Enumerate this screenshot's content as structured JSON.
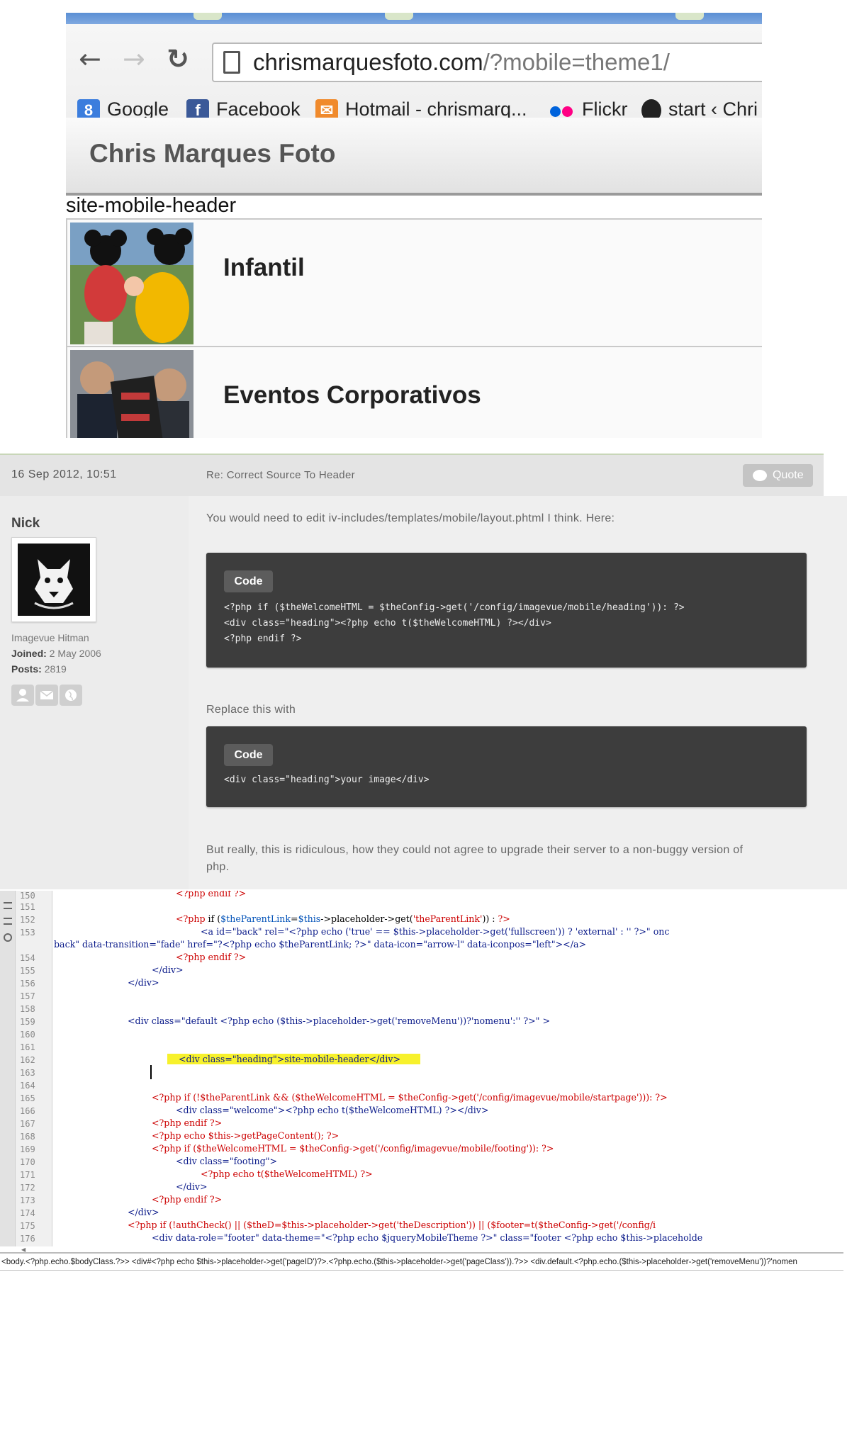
{
  "browser": {
    "url_host": "chrismarquesfoto.com",
    "url_path": "/?mobile=theme1/",
    "bookmarks": [
      {
        "label": "Google",
        "icon": "google-icon"
      },
      {
        "label": "Facebook",
        "icon": "facebook-icon"
      },
      {
        "label": "Hotmail - chrismarq...",
        "icon": "hotmail-icon"
      },
      {
        "label": "Flickr",
        "icon": "flickr-icon"
      },
      {
        "label": "start ‹ Chri",
        "icon": "wordpress-icon"
      }
    ],
    "site_title": "Chris Marques Foto",
    "raw_header_text": "site-mobile-header",
    "list": [
      {
        "label": "Infantil"
      },
      {
        "label": "Eventos Corporativos"
      }
    ]
  },
  "post": {
    "date": "16 Sep 2012, 10:51",
    "subject": "Re: Correct Source To Header",
    "quote_label": "Quote",
    "author": {
      "name": "Nick",
      "rank": "Imagevue Hitman",
      "joined_label": "Joined:",
      "joined_value": "2 May 2006",
      "posts_label": "Posts:",
      "posts_value": "2819"
    },
    "intro_text": "You would need to edit iv-includes/templates/mobile/layout.phtml I think. Here:",
    "code_label": "Code",
    "code1": [
      "<?php if ($theWelcomeHTML = $theConfig->get('/config/imagevue/mobile/heading')): ?>",
      "<div class=\"heading\"><?php echo t($theWelcomeHTML) ?></div>",
      "<?php endif ?>"
    ],
    "replace_text": "Replace this with",
    "code2": [
      "<div class=\"heading\">your image</div>"
    ],
    "closing_text_1": "But really, this is ridiculous, how they could not agree to upgrade their server to a non-buggy version of",
    "closing_text_2": "php."
  },
  "editor": {
    "line_numbers": [
      "150",
      "151",
      "152",
      "153",
      "",
      "154",
      "155",
      "156",
      "157",
      "158",
      "159",
      "160",
      "161",
      "162",
      "163",
      "164",
      "165",
      "166",
      "167",
      "168",
      "169",
      "170",
      "171",
      "172",
      "173",
      "174",
      "175",
      "176"
    ],
    "lines": {
      "l150": "<?php endif ?>",
      "l152a": "<?php",
      "l152b": " if (",
      "l152c": "$theParentLink",
      "l152d": "=",
      "l152e": "$this",
      "l152f": "->placeholder->get(",
      "l152g": "'theParentLink'",
      "l152h": ")) : ",
      "l152i": "?>",
      "l153": "<a id=\"back\" rel=\"<?php echo ('true' == $this->placeholder->get('fullscreen')) ? 'external' : '' ?>\" onc",
      "l153b": "back\" data-transition=\"fade\" href=\"?<?php echo $theParentLink; ?>\" data-icon=\"arrow-l\" data-iconpos=\"left\"></a>",
      "l154": "<?php endif ?>",
      "l155": "</div>",
      "l156": "</div>",
      "l159": "<div class=\"default <?php echo ($this->placeholder->get('removeMenu'))?'nomenu':'' ?>\" >",
      "l162": " <div class=\"heading\">site-mobile-header</div> ",
      "l165": "<?php if (!$theParentLink && ($theWelcomeHTML = $theConfig->get('/config/imagevue/mobile/startpage'))): ?>",
      "l166": "<div class=\"welcome\"><?php echo t($theWelcomeHTML) ?></div>",
      "l167": "<?php endif ?>",
      "l168": "<?php echo $this->getPageContent(); ?>",
      "l169": "<?php if ($theWelcomeHTML = $theConfig->get('/config/imagevue/mobile/footing')): ?>",
      "l170": "<div class=\"footing\">",
      "l171": "<?php echo t($theWelcomeHTML) ?>",
      "l172": "</div>",
      "l173": "<?php endif ?>",
      "l174": "</div>",
      "l175": "<?php if (!authCheck() || ($theD=$this->placeholder->get('theDescription')) || ($footer=t($theConfig->get('/config/i",
      "l176": "<div data-role=\"footer\" data-theme=\"<?php echo $jqueryMobileTheme ?>\" class=\"footer <?php echo $this->placeholde"
    },
    "statusbar": "<body.<?php.echo.$bodyClass.?>> <div#<?php echo $this->placeholder->get('pageID')?>.<?php.echo.($this->placeholder->get('pageClass')).?>> <div.default.<?php.echo.($this->placeholder->get('removeMenu'))?'nomen"
  },
  "colors": {
    "php_tag": "#cc0000",
    "variable": "#0051b8",
    "highlight": "#f7f12c",
    "code_bg": "#3d3d3d"
  }
}
